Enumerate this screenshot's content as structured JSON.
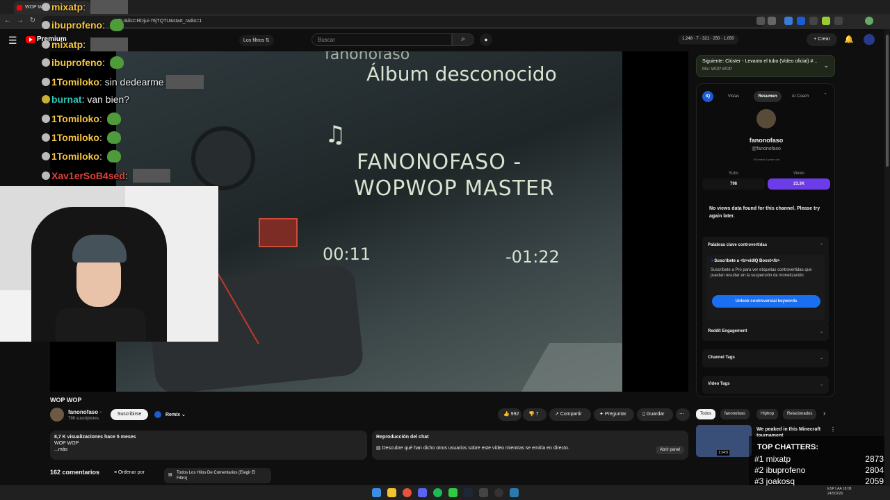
{
  "browser": {
    "tab_title": "WOP WO",
    "url": "TU&list=RDjui-76jTQTU&start_radio=1"
  },
  "header": {
    "brand": "Premium",
    "filters": "Los filtros",
    "search_placeholder": "Buscar",
    "stats": "1,248 · 7 · 321 · 250 · 1,050",
    "create": "Crear"
  },
  "overlay_chat": [
    {
      "user": "mixatp",
      "text": "",
      "color": "#f5c542",
      "emote": "image"
    },
    {
      "user": "ibuprofeno",
      "text": "",
      "color": "#f5c542",
      "emote": "pepe"
    },
    {
      "user": "mixatp",
      "text": "",
      "color": "#f5c542",
      "emote": "image"
    },
    {
      "user": "ibuprofeno",
      "text": "",
      "color": "#f5c542",
      "emote": "pepe"
    },
    {
      "user": "1Tomiloko",
      "text": "sin dedearme",
      "color": "#f5c542",
      "emote": "image"
    },
    {
      "user": "burnat",
      "text": "van bien?",
      "color": "#2ec4b6",
      "emote": ""
    },
    {
      "user": "1Tomiloko",
      "text": "",
      "color": "#f5c542",
      "emote": "pepe"
    },
    {
      "user": "1Tomiloko",
      "text": "",
      "color": "#f5c542",
      "emote": "pepe"
    },
    {
      "user": "1Tomiloko",
      "text": "",
      "color": "#f5c542",
      "emote": "pepe"
    },
    {
      "user": "Xav1erSoB4sed",
      "text": "",
      "color": "#e0413b",
      "emote": "image"
    }
  ],
  "video_frame": {
    "artist_partial": "fanonofaso",
    "album": "Álbum desconocido",
    "title_line1": "FANONOFASO -",
    "title_line2": "WOPWOP MASTER",
    "elapsed": "00:11",
    "remaining": "-01:22"
  },
  "video": {
    "title": "WOP WOP",
    "channel": "fanonofaso",
    "subscribers": "798 suscriptores",
    "subscribe": "Suscribirse",
    "remix": "Remix",
    "likes": "992",
    "dislikes": "7",
    "share": "Compartir",
    "ask": "Preguntar",
    "save": "Guardar"
  },
  "description": {
    "meta": "8,7 K visualizaciones  hace 5 meses",
    "text": "WOP WOP",
    "more": "...más"
  },
  "chat_replay": {
    "title": "Reproducción del chat",
    "text": "Descubre qué han dicho otros usuarios sobre este vídeo mientras se emitía en directo.",
    "button": "Abrir panel"
  },
  "comments": {
    "count": "162 comentarios",
    "sort": "Ordenar por",
    "threads": "Todos Los Hilos De Comentarios (Elegir El Filtro)"
  },
  "up_next": {
    "label": "Siguiente: Clúster - Levanto el tubo (Video oficial) #...",
    "mix": "Mix: WOP WOP"
  },
  "vidiq": {
    "logo": "IQ",
    "tabs": [
      "Vistas",
      "Resumen",
      "AI Coach"
    ],
    "channel_name": "fanonofaso",
    "handle": "@fanonofaso",
    "pills": "18 videos    4 years old",
    "subs_label": "Subs",
    "subs_value": "798",
    "views_label": "Views",
    "views_value": "23.3K",
    "no_views": "No views data found for this channel. Please try again later.",
    "keywords_title": "Palabras clave controvertidas",
    "boost_title": "Suscríbete a <b>vidIQ Boost</b>",
    "boost_desc": "Suscríbete a Pro para ver etiquetas controvertidas que puedan resultar en la suspensión de monetización",
    "unlock": "Unlock controversial keywords",
    "reddit": "Reddit Engagement",
    "channel_tags": "Channel Tags",
    "video_tags": "Video Tags",
    "accent": "#6b3ce8"
  },
  "chips": [
    "Todos",
    "fanonofaso",
    "Hiphop",
    "Relacionados"
  ],
  "recommendation": {
    "title": "We peaked in this Minecraft tournament",
    "duration": "1:34:0"
  },
  "top_chatters": {
    "title": "TOP CHATTERS:",
    "rows": [
      {
        "rank": "#1",
        "name": "mixatp",
        "score": "2873"
      },
      {
        "rank": "#2",
        "name": "ibuprofeno",
        "score": "2804"
      },
      {
        "rank": "#3",
        "name": "joakosq",
        "score": "2059"
      }
    ]
  },
  "taskbar": {
    "lang": "ESP LAA",
    "time": "18:08",
    "date": "24/5/2026"
  }
}
